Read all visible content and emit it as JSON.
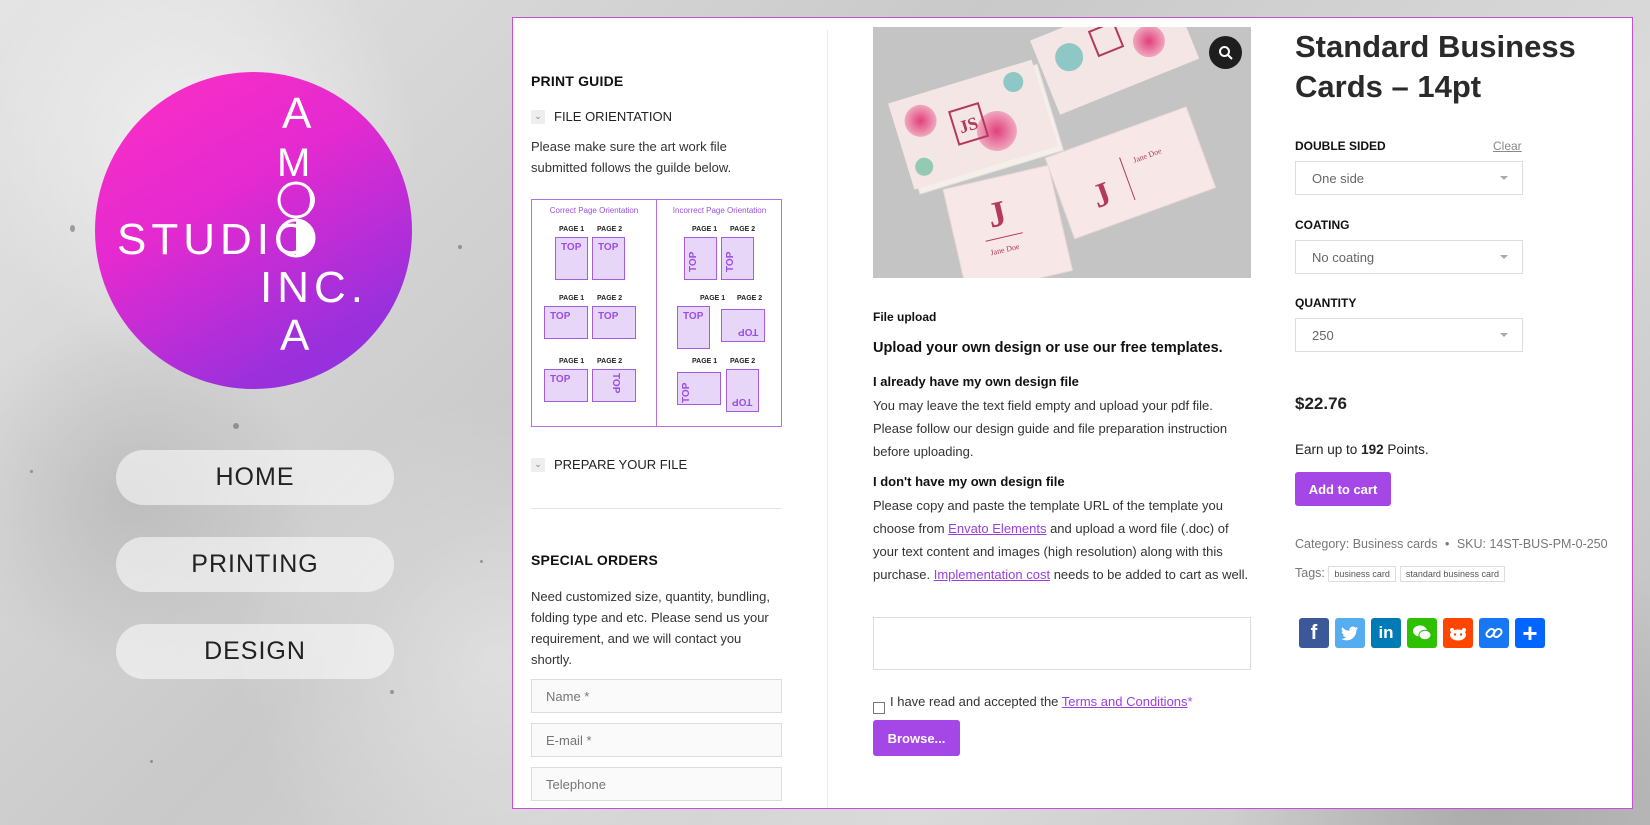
{
  "logo": {
    "text_studio": "STUDIO",
    "text_amo": "AMO",
    "text_inc": "INC.",
    "text_a": "A",
    "gradient_start": "#ff2fc3",
    "gradient_end": "#8a33e0"
  },
  "nav": {
    "items": [
      {
        "label": "HOME"
      },
      {
        "label": "PRINTING"
      },
      {
        "label": "DESIGN"
      }
    ]
  },
  "sidebar": {
    "print_guide_title": "PRINT GUIDE",
    "file_orientation_label": "FILE ORIENTATION",
    "orientation_text": "Please make sure the art work file submitted follows the guilde below.",
    "guide": {
      "correct_title": "Correct Page Orientation",
      "incorrect_title": "Incorrect Page Orientation",
      "page1": "PAGE 1",
      "page2": "PAGE 2",
      "top": "TOP"
    },
    "prepare_label": "PREPARE YOUR FILE",
    "special_orders_title": "SPECIAL ORDERS",
    "special_orders_text": "Need customized size, quantity, bundling, folding type and etc. Please send us your requirement, and we will contact you shortly.",
    "name_placeholder": "Name *",
    "email_placeholder": "E-mail *",
    "phone_placeholder": "Telephone"
  },
  "center": {
    "file_upload_label": "File upload",
    "upload_heading": "Upload your own design or use our free templates.",
    "have_file_heading": "I already have my own design file",
    "have_file_text": "You may leave the text field empty and upload your pdf file. Please follow our design guide and file preparation instruction before uploading.",
    "no_file_heading": "I don't have my own design file",
    "no_file_text_1": "Please copy and paste the template URL of the template you choose from",
    "envato_link": "Envato Elements",
    "no_file_text_2": "and upload a word file (.doc) of your text content and images (high resolution) along with this purchase.",
    "impl_link": "Implementation cost",
    "no_file_text_3": "needs to be added to cart as well.",
    "terms_prefix": "I have read and accepted the",
    "terms_link": "Terms and Conditions",
    "terms_required": "*",
    "browse_label": "Browse...",
    "card_name": "Jane Doe",
    "card_initials": "JS",
    "card_letter": "J"
  },
  "product": {
    "title": "Standard Business Cards – 14pt",
    "double_sided_label": "DOUBLE SIDED",
    "clear_label": "Clear",
    "double_sided_value": "One side",
    "coating_label": "COATING",
    "coating_value": "No coating",
    "quantity_label": "QUANTITY",
    "quantity_value": "250",
    "price": "$22.76",
    "points_prefix": "Earn up to",
    "points_value": "192",
    "points_suffix": "Points.",
    "add_to_cart": "Add to cart",
    "category_label": "Category:",
    "category_value": "Business cards",
    "sku_label": "SKU:",
    "sku_value": "14ST-BUS-PM-0-250",
    "tags_label": "Tags:",
    "tags": [
      "business card",
      "standard business card"
    ],
    "accent": "#a546e6"
  },
  "share": {
    "icons": [
      "facebook-icon",
      "twitter-icon",
      "linkedin-icon",
      "wechat-icon",
      "reddit-icon",
      "copy-link-icon",
      "share-plus-icon"
    ],
    "colors": [
      "#3b5998",
      "#55acee",
      "#007bb5",
      "#2dc100",
      "#ff4500",
      "#1877f2",
      "#0166ff"
    ]
  }
}
